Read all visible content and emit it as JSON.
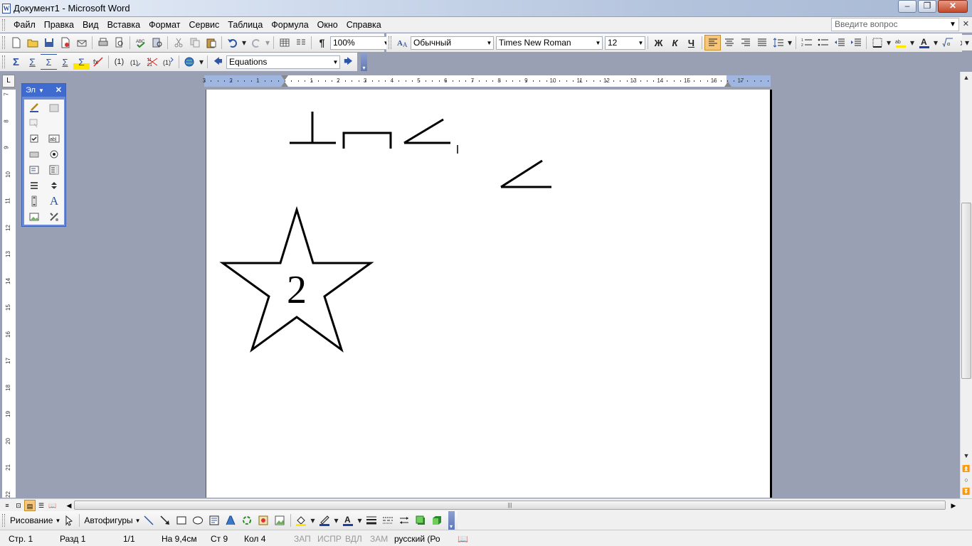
{
  "window": {
    "title": "Документ1 - Microsoft Word",
    "app_icon_letter": "W"
  },
  "menu": {
    "items": [
      "Файл",
      "Правка",
      "Вид",
      "Вставка",
      "Формат",
      "Сервис",
      "Таблица",
      "Формула",
      "Окно",
      "Справка"
    ],
    "ask_placeholder": "Введите вопрос"
  },
  "standard_toolbar": {
    "zoom": "100%"
  },
  "formatting_toolbar": {
    "style": "Обычный",
    "font": "Times New Roman",
    "size": "12",
    "bold": "Ж",
    "italic": "К",
    "underline": "Ч",
    "superscript": "x²",
    "subscript": "x₂"
  },
  "equation_toolbar": {
    "combo_value": "Equations",
    "numbering_label": "(1)"
  },
  "ruler": {
    "ticks": [
      "3",
      "2",
      "1",
      "1",
      "2",
      "3",
      "4",
      "5",
      "6",
      "7",
      "8",
      "9",
      "10",
      "11",
      "12",
      "13",
      "14",
      "15",
      "16",
      "17"
    ],
    "vticks": [
      "7",
      "8",
      "9",
      "10",
      "11",
      "12",
      "13",
      "14",
      "15",
      "16",
      "17",
      "18",
      "19",
      "20",
      "21",
      "22"
    ]
  },
  "toolbox": {
    "title": "Эл"
  },
  "document": {
    "star_label": "2"
  },
  "drawing_toolbar": {
    "draw_label": "Рисование",
    "autoshapes_label": "Автофигуры"
  },
  "status": {
    "page": "Стр. 1",
    "section": "Разд 1",
    "pages": "1/1",
    "at": "На 9,4см",
    "line": "Ст 9",
    "col": "Кол 4",
    "rec": "ЗАП",
    "trk": "ИСПР",
    "ext": "ВДЛ",
    "ovr": "ЗАМ",
    "lang": "русский (Ро"
  },
  "colors": {
    "highlight": "#f7c67b",
    "ruler_margin": "#9fb6e0",
    "workspace": "#9aa0b4",
    "toolbox": "#6b8cd8"
  }
}
